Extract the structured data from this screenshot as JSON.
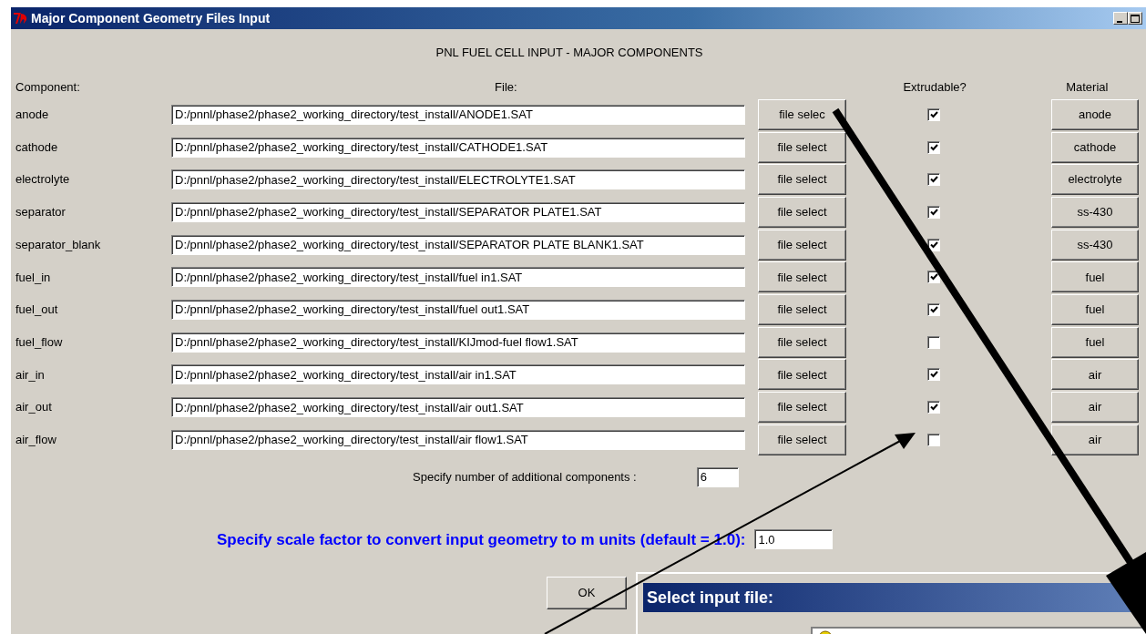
{
  "window": {
    "title": "Major Component Geometry Files Input"
  },
  "heading": "PNL FUEL CELL INPUT - MAJOR COMPONENTS",
  "columns": {
    "component": "Component:",
    "file": "File:",
    "extrudable": "Extrudable?",
    "material": "Material"
  },
  "rows": [
    {
      "component": "anode",
      "file": "D:/pnnl/phase2/phase2_working_directory/test_install/ANODE1.SAT",
      "button": "file selec",
      "extrudable": true,
      "material": "anode"
    },
    {
      "component": "cathode",
      "file": "D:/pnnl/phase2/phase2_working_directory/test_install/CATHODE1.SAT",
      "button": "file select",
      "extrudable": true,
      "material": "cathode"
    },
    {
      "component": "electrolyte",
      "file": "D:/pnnl/phase2/phase2_working_directory/test_install/ELECTROLYTE1.SAT",
      "button": "file select",
      "extrudable": true,
      "material": "electrolyte"
    },
    {
      "component": "separator",
      "file": "D:/pnnl/phase2/phase2_working_directory/test_install/SEPARATOR PLATE1.SAT",
      "button": "file select",
      "extrudable": true,
      "material": "ss-430"
    },
    {
      "component": "separator_blank",
      "file": "D:/pnnl/phase2/phase2_working_directory/test_install/SEPARATOR PLATE BLANK1.SAT",
      "button": "file select",
      "extrudable": true,
      "material": "ss-430"
    },
    {
      "component": "fuel_in",
      "file": "D:/pnnl/phase2/phase2_working_directory/test_install/fuel in1.SAT",
      "button": "file select",
      "extrudable": true,
      "material": "fuel"
    },
    {
      "component": "fuel_out",
      "file": "D:/pnnl/phase2/phase2_working_directory/test_install/fuel out1.SAT",
      "button": "file select",
      "extrudable": true,
      "material": "fuel"
    },
    {
      "component": "fuel_flow",
      "file": "D:/pnnl/phase2/phase2_working_directory/test_install/KIJmod-fuel flow1.SAT",
      "button": "file select",
      "extrudable": false,
      "material": "fuel"
    },
    {
      "component": "air_in",
      "file": "D:/pnnl/phase2/phase2_working_directory/test_install/air in1.SAT",
      "button": "file select",
      "extrudable": true,
      "material": "air"
    },
    {
      "component": "air_out",
      "file": "D:/pnnl/phase2/phase2_working_directory/test_install/air out1.SAT",
      "button": "file select",
      "extrudable": true,
      "material": "air"
    },
    {
      "component": "air_flow",
      "file": "D:/pnnl/phase2/phase2_working_directory/test_install/air flow1.SAT",
      "button": "file select",
      "extrudable": false,
      "material": "air"
    }
  ],
  "additional": {
    "label": "Specify number of additional components :",
    "value": "6"
  },
  "scale": {
    "label": "Specify scale factor to convert input geometry to m units (default = 1.0):",
    "value": "1.0"
  },
  "ok_button": "OK",
  "dialog": {
    "title": "Select input file:"
  }
}
